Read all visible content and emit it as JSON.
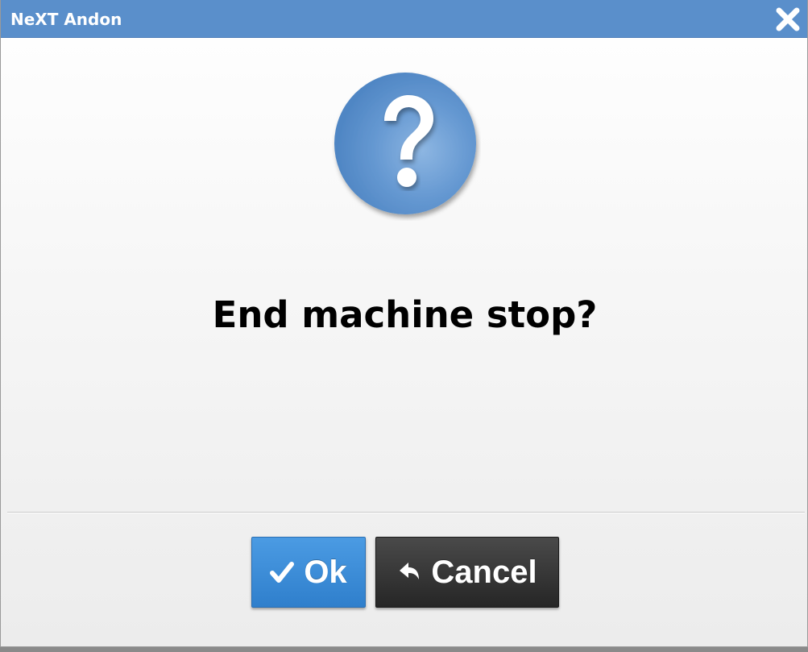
{
  "dialog": {
    "title": "NeXT Andon",
    "message": "End machine stop?",
    "close_icon": "close-icon",
    "question_icon": "question-icon"
  },
  "buttons": {
    "ok_label": "Ok",
    "ok_icon": "check-icon",
    "cancel_label": "Cancel",
    "cancel_icon": "reply-arrow-icon"
  },
  "colors": {
    "title_bar": "#5a8fcb",
    "ok_button": "#2f7fcc",
    "cancel_button": "#2b2b2b",
    "question_icon": "#5a8fcb"
  }
}
